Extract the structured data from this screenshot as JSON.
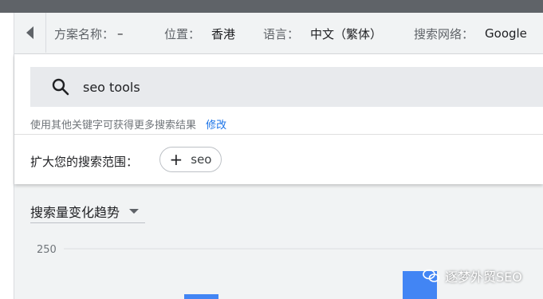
{
  "header": {
    "plan_name_label": "方案名称：",
    "plan_name_value": "–",
    "location_label": "位置：",
    "location_value": "香港",
    "language_label": "语言：",
    "language_value": "中文（繁体）",
    "network_label": "搜索网络：",
    "network_value": "Google"
  },
  "search": {
    "query": "seo tools",
    "hint": "使用其他关键字可获得更多搜索结果",
    "modify_link": "修改"
  },
  "expand": {
    "label": "扩大您的搜索范围：",
    "chip_label": "seo"
  },
  "trend": {
    "dropdown_label": "搜索量变化趋势"
  },
  "chart_data": {
    "type": "bar",
    "y_tick": "250",
    "colors": {
      "bar": "#4285f4",
      "grid": "#dadce0"
    }
  },
  "watermark": {
    "text": "逐梦外贸SEO"
  },
  "icons": {
    "back": "chevron-left-icon",
    "search": "search-icon",
    "plus": "plus-icon",
    "caret": "caret-down-icon",
    "wechat": "wechat-icon"
  }
}
